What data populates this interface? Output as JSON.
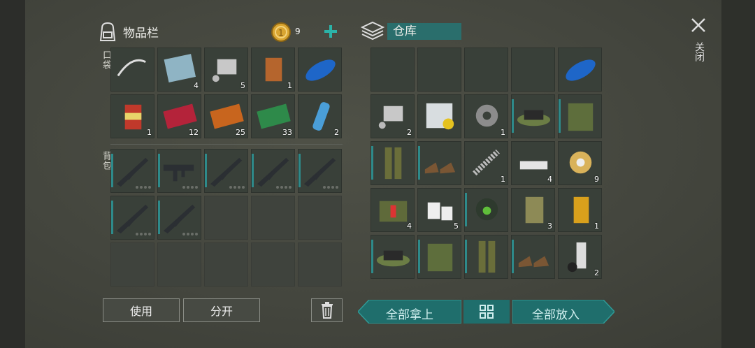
{
  "inventory": {
    "title": "物品栏",
    "coins": "9",
    "pocket_label": "口袋",
    "backpack_label": "背包",
    "pocket_slots": [
      {
        "item": "crossbow-scope",
        "qty": ""
      },
      {
        "item": "metal-plate",
        "qty": "4"
      },
      {
        "item": "engine-parts",
        "qty": "5"
      },
      {
        "item": "rusty-can",
        "qty": "1"
      },
      {
        "item": "blue-gas-tank",
        "qty": ""
      },
      {
        "item": "food-can",
        "qty": "1"
      },
      {
        "item": "combat-coupon",
        "qty": "12"
      },
      {
        "item": "ammo-coupon",
        "qty": "25"
      },
      {
        "item": "ration-coupon",
        "qty": "33"
      },
      {
        "item": "water-bottle",
        "qty": "2"
      }
    ],
    "backpack_slots": [
      {
        "item": "rifle",
        "qty": ""
      },
      {
        "item": "smg",
        "qty": ""
      },
      {
        "item": "rifle",
        "qty": ""
      },
      {
        "item": "rifle",
        "qty": ""
      },
      {
        "item": "rifle",
        "qty": ""
      },
      {
        "item": "rifle",
        "qty": ""
      },
      {
        "item": "rifle",
        "qty": ""
      }
    ],
    "use_label": "使用",
    "split_label": "分开"
  },
  "storage": {
    "title": "仓库",
    "close_label": "关闭",
    "take_all_label": "全部拿上",
    "put_all_label": "全部放入",
    "slots": [
      {
        "item": "",
        "qty": ""
      },
      {
        "item": "",
        "qty": ""
      },
      {
        "item": "",
        "qty": ""
      },
      {
        "item": "",
        "qty": ""
      },
      {
        "item": "blue-gas-tank",
        "qty": ""
      },
      {
        "item": "engine-parts",
        "qty": "2"
      },
      {
        "item": "hazmat-map",
        "qty": ""
      },
      {
        "item": "gear",
        "qty": "1"
      },
      {
        "item": "boonie-hat",
        "qty": ""
      },
      {
        "item": "camo-jacket",
        "qty": ""
      },
      {
        "item": "camo-pants",
        "qty": ""
      },
      {
        "item": "boots",
        "qty": ""
      },
      {
        "item": "spring",
        "qty": "1"
      },
      {
        "item": "metal-ingots",
        "qty": "4"
      },
      {
        "item": "wire-spool",
        "qty": "9"
      },
      {
        "item": "medkit-bag",
        "qty": "4"
      },
      {
        "item": "bandages",
        "qty": "5"
      },
      {
        "item": "gas-mask",
        "qty": ""
      },
      {
        "item": "jerrycan",
        "qty": "3"
      },
      {
        "item": "oil-filter",
        "qty": "1"
      },
      {
        "item": "boonie-hat",
        "qty": ""
      },
      {
        "item": "camo-jacket",
        "qty": ""
      },
      {
        "item": "camo-pants",
        "qty": ""
      },
      {
        "item": "boots",
        "qty": ""
      },
      {
        "item": "spray-can",
        "qty": "2"
      }
    ]
  },
  "colors": {
    "accent_teal": "#1f6e6c",
    "coin_gold": "#d9a531",
    "plus_teal": "#2bb3a8"
  }
}
